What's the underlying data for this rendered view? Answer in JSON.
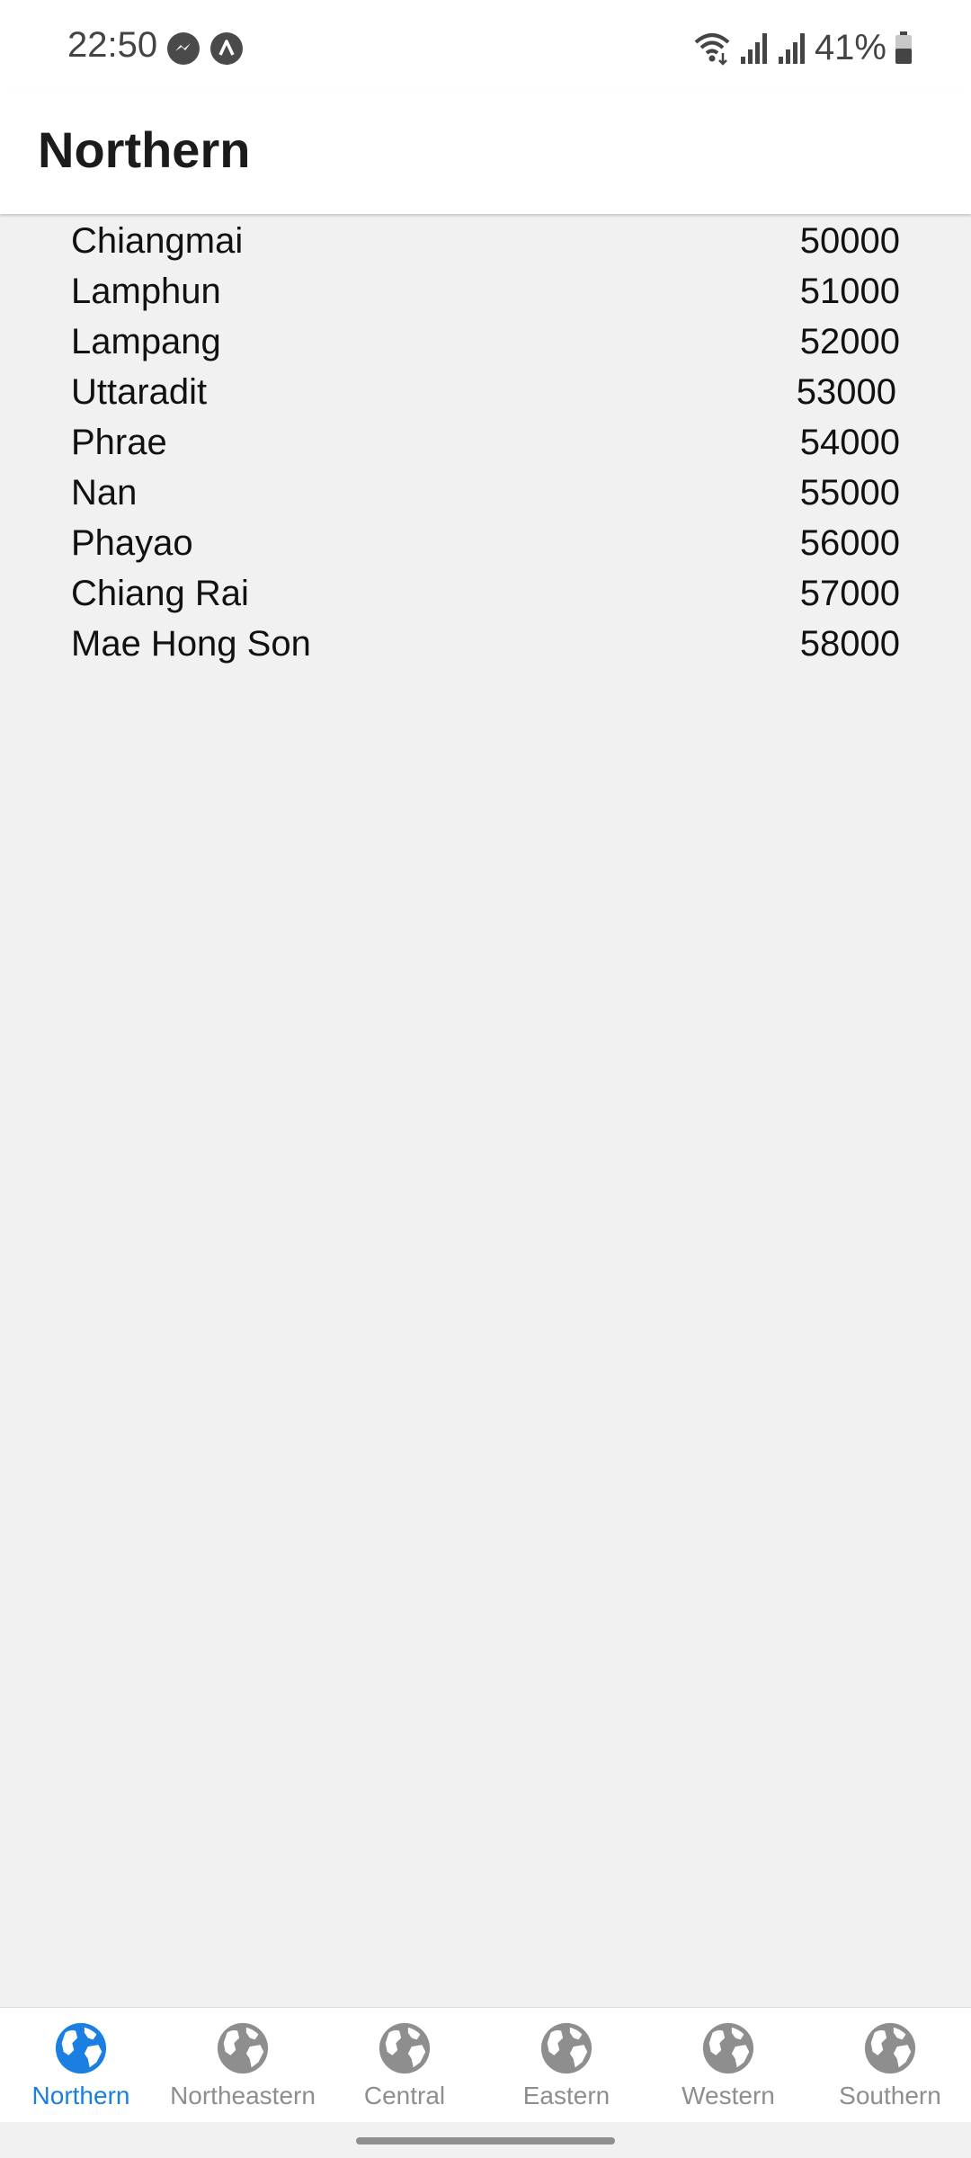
{
  "status_bar": {
    "time": "22:50",
    "left_icons": [
      "messenger-icon",
      "app-notification-icon"
    ],
    "right_icons": [
      "wifi-icon",
      "signal-icon",
      "signal-icon",
      "battery-icon"
    ],
    "battery": "41%"
  },
  "header": {
    "title": "Northern"
  },
  "list": [
    {
      "name": "Chiangmai",
      "code": "50000"
    },
    {
      "name": "Lamphun",
      "code": "51000"
    },
    {
      "name": "Lampang",
      "code": "52000"
    },
    {
      "name": "Uttaradit",
      "code": "53000"
    },
    {
      "name": "Phrae",
      "code": "54000"
    },
    {
      "name": "Nan",
      "code": "55000"
    },
    {
      "name": "Phayao",
      "code": "56000"
    },
    {
      "name": "Chiang Rai",
      "code": "57000"
    },
    {
      "name": "Mae Hong Son",
      "code": "58000"
    }
  ],
  "tabs": [
    {
      "label": "Northern",
      "icon": "globe-icon",
      "active": true
    },
    {
      "label": "Northeastern",
      "icon": "globe-icon",
      "active": false
    },
    {
      "label": "Central",
      "icon": "globe-icon",
      "active": false
    },
    {
      "label": "Eastern",
      "icon": "globe-icon",
      "active": false
    },
    {
      "label": "Western",
      "icon": "globe-icon",
      "active": false
    },
    {
      "label": "Southern",
      "icon": "globe-icon",
      "active": false
    }
  ],
  "colors": {
    "accent": "#1a7fe0",
    "inactive": "#8e8e8e",
    "background": "#f1f1f1"
  }
}
